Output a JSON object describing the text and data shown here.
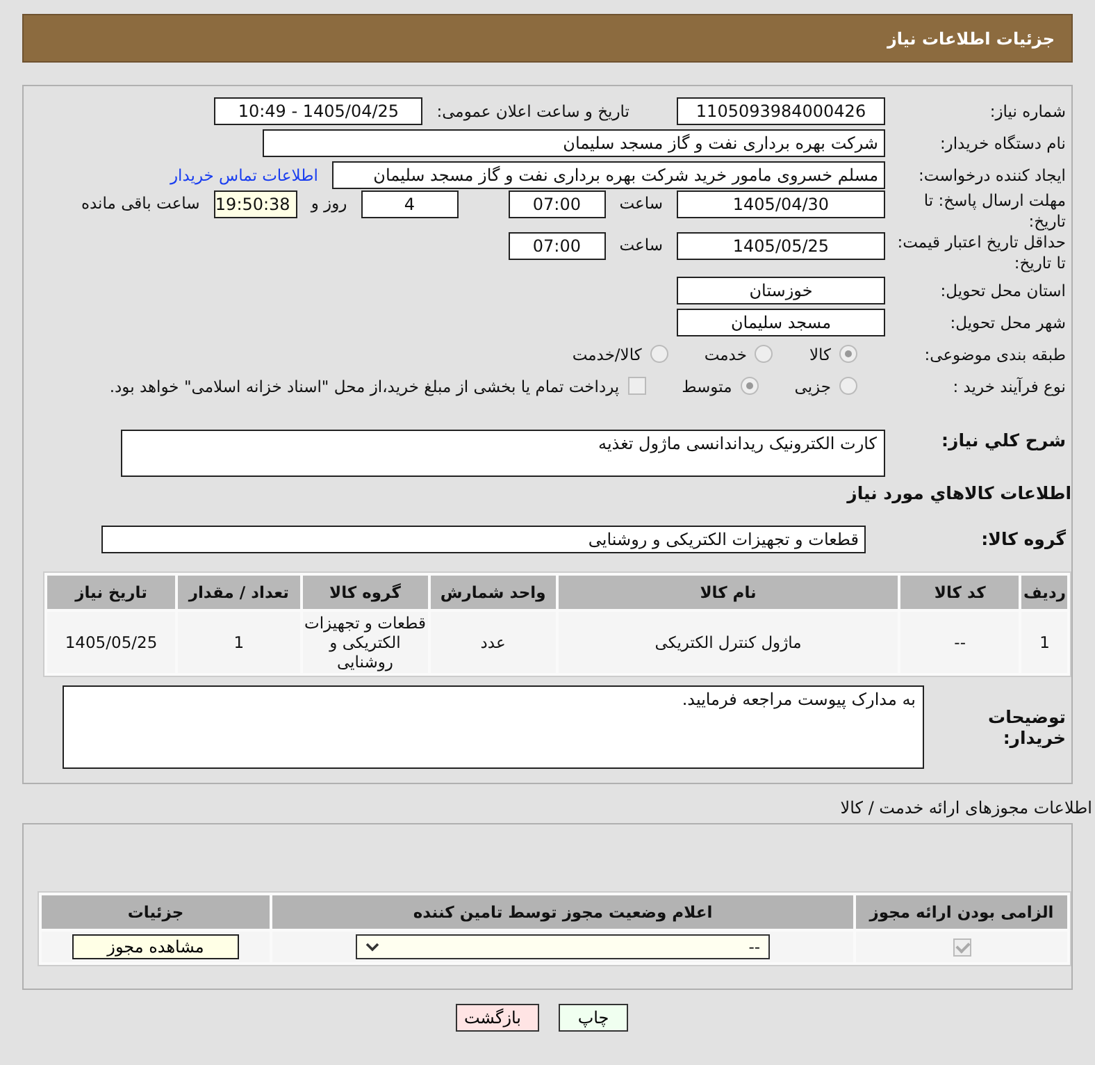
{
  "header": {
    "title": "جزئیات اطلاعات نیاز"
  },
  "need_number": {
    "label": "شماره نیاز:",
    "value": "1105093984000426"
  },
  "announce": {
    "label": "تاریخ و ساعت اعلان عمومی:",
    "value": "1405/04/25 - 10:49"
  },
  "buyer": {
    "label": "نام دستگاه خریدار:",
    "value": "شرکت بهره برداری نفت و گاز مسجد سلیمان"
  },
  "creator": {
    "label": "ایجاد کننده درخواست:",
    "value": "مسلم خسروی مامور خرید شرکت بهره برداری نفت و گاز مسجد سلیمان",
    "link": "اطلاعات تماس خریدار"
  },
  "deadline": {
    "label": "مهلت ارسال پاسخ: تا تاریخ:",
    "date": "1405/04/30",
    "time_label": "ساعت",
    "time": "07:00",
    "days": "4",
    "days_label": "روز و",
    "remaining": "19:50:38",
    "remaining_label": "ساعت باقی مانده"
  },
  "validity": {
    "label": "حداقل تاریخ اعتبار قیمت: تا تاریخ:",
    "date": "1405/05/25",
    "time_label": "ساعت",
    "time": "07:00"
  },
  "province": {
    "label": "استان محل تحویل:",
    "value": "خوزستان"
  },
  "city": {
    "label": "شهر محل تحویل:",
    "value": "مسجد سلیمان"
  },
  "category": {
    "label": "طبقه بندی موضوعی:",
    "options": [
      {
        "label": "کالا",
        "selected": true
      },
      {
        "label": "خدمت",
        "selected": false
      },
      {
        "label": "کالا/خدمت",
        "selected": false
      }
    ]
  },
  "process": {
    "label": "نوع فرآیند خرید :",
    "options": [
      {
        "label": "جزیی",
        "selected": false
      },
      {
        "label": "متوسط",
        "selected": true
      }
    ],
    "payment": {
      "label": "پرداخت تمام یا بخشی از مبلغ خرید،از محل \"اسناد خزانه اسلامی\" خواهد بود.",
      "checked": false
    }
  },
  "description": {
    "label": "شرح کلي نياز:",
    "value": "کارت الکترونیک ریداندانسی ماژول تغذیه"
  },
  "goods_title": "اطلاعات کالاهاي مورد نياز",
  "group": {
    "label": "گروه کالا:",
    "value": "قطعات و تجهیزات الکتریکی و روشنایی"
  },
  "goods_table": {
    "columns": [
      "ردیف",
      "کد کالا",
      "نام کالا",
      "واحد شمارش",
      "گروه کالا",
      "تعداد / مقدار",
      "تاریخ نیاز"
    ],
    "rows": [
      [
        "1",
        "--",
        "ماژول کنترل الکتریکی",
        "عدد",
        "قطعات و تجهیزات الکتریکی و روشنایی",
        "1",
        "1405/05/25"
      ]
    ]
  },
  "buyer_notes": {
    "label": "توضیحات خریدار:",
    "value": "به مدارک پیوست مراجعه فرمایید."
  },
  "licenses": {
    "title": "اطلاعات مجوزهای ارائه خدمت / کالا",
    "columns": [
      "الزامی بودن ارائه مجوز",
      "اعلام وضعیت مجوز توسط تامین کننده",
      "جزئیات"
    ],
    "rows": [
      {
        "required": true,
        "status": "--",
        "button": "مشاهده مجوز"
      }
    ]
  },
  "buttons": [
    {
      "label": "چاپ",
      "kind": "print"
    },
    {
      "label": "بازگشت",
      "kind": "back"
    }
  ]
}
